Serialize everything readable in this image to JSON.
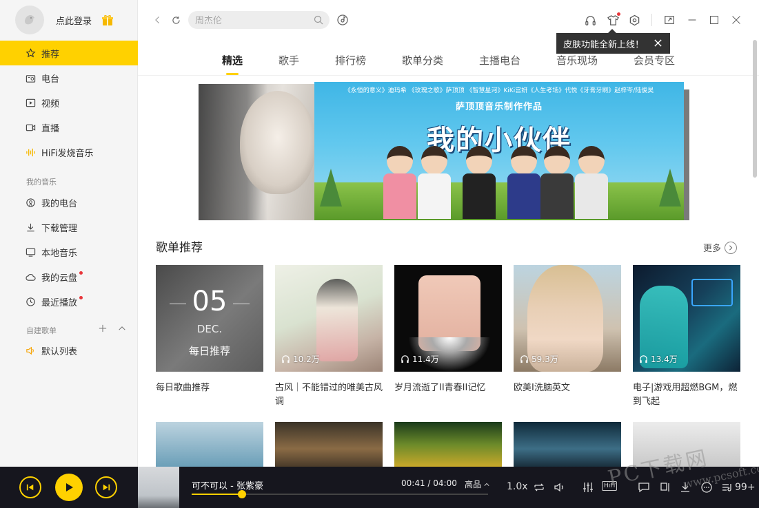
{
  "sidebar": {
    "login_text": "点此登录",
    "items": [
      {
        "label": "推荐",
        "icon": "star-icon",
        "active": true
      },
      {
        "label": "电台",
        "icon": "radio-icon"
      },
      {
        "label": "视频",
        "icon": "video-icon"
      },
      {
        "label": "直播",
        "icon": "live-icon"
      },
      {
        "label": "HiFi发烧音乐",
        "icon": "hifi-wave-icon"
      }
    ],
    "my_music_title": "我的音乐",
    "my_items": [
      {
        "label": "我的电台",
        "icon": "my-radio-icon"
      },
      {
        "label": "下载管理",
        "icon": "download-icon"
      },
      {
        "label": "本地音乐",
        "icon": "monitor-icon"
      },
      {
        "label": "我的云盘",
        "icon": "cloud-icon",
        "dot": true
      },
      {
        "label": "最近播放",
        "icon": "clock-icon",
        "dot": true
      }
    ],
    "playlist_title": "自建歌单",
    "playlists": [
      {
        "label": "默认列表",
        "icon": "speaker-icon"
      }
    ]
  },
  "search": {
    "placeholder": "周杰伦"
  },
  "tooltip": {
    "text": "皮肤功能全新上线！"
  },
  "tabs": [
    "精选",
    "歌手",
    "排行榜",
    "歌单分类",
    "主播电台",
    "音乐现场",
    "会员专区"
  ],
  "banner": {
    "topline": "《永恒的意义》迪玛希 《玫瑰之歌》萨顶顶 《智慧星河》KiKi宫妍《人生考场》代悦《牙膏牙刷》赵梓岑/陆俊昊",
    "producer": "萨顶顶音乐制作作品",
    "headline": "我的小伙伴"
  },
  "section": {
    "title": "歌单推荐",
    "more": "更多"
  },
  "cards": [
    {
      "title": "每日歌曲推荐",
      "day": "05",
      "month": "DEC.",
      "label": "每日推荐"
    },
    {
      "title": "古风｜不能错过的唯美古风调",
      "plays": "10.2万"
    },
    {
      "title": "岁月流逝了II青春II记忆",
      "plays": "11.4万"
    },
    {
      "title": "欧美I洗脑英文",
      "plays": "59.3万"
    },
    {
      "title": "电子|游戏用超燃BGM，燃到飞起",
      "plays": "13.4万"
    }
  ],
  "player": {
    "song": "可不可以 - 张紫豪",
    "time": "00:41 / 04:00",
    "quality": "高品",
    "speed": "1.0x",
    "hifi": "HiFi",
    "count": "99+",
    "progress": 0.17
  },
  "watermark": "PC下载网",
  "watermark_url": "www.pcsoft.com.cn",
  "colors": {
    "accent": "#ffd100",
    "player_bg": "#16161e",
    "dot": "#e8353a"
  }
}
